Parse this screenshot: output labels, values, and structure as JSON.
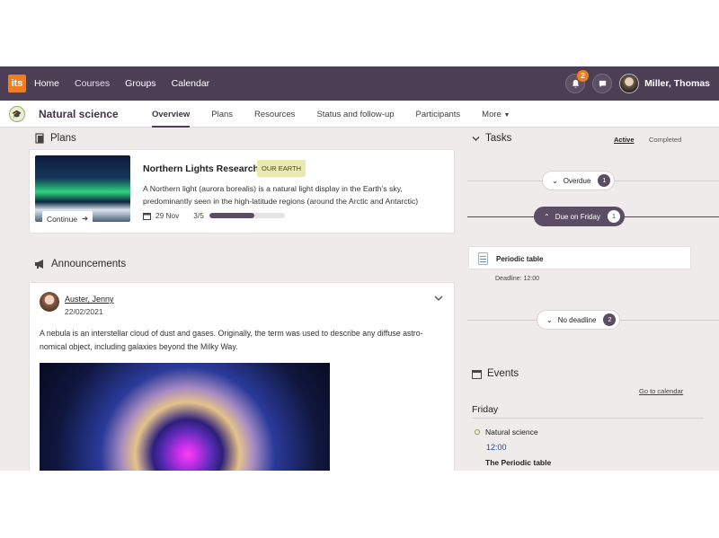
{
  "topbar": {
    "logo": "its",
    "nav": [
      "Home",
      "Courses",
      "Groups",
      "Calendar"
    ],
    "active_nav": "Courses",
    "notification_count": "2",
    "user_name": "Miller, Thomas"
  },
  "subnav": {
    "course_title": "Natural science",
    "tabs": [
      "Overview",
      "Plans",
      "Resources",
      "Status and follow-up",
      "Participants",
      "More"
    ],
    "active_tab": "Overview"
  },
  "plans": {
    "heading": "Plans",
    "card": {
      "continue_label": "Continue",
      "title": "Northern Lights Research",
      "tag": "OUR EARTH",
      "description_line1": "A Northern light (aurora borealis) is a natural light display in the Earth's sky,",
      "description_line2": "predominantly seen in the high-latitude regions (around the Arctic and Antarctic)",
      "date": "29 Nov",
      "progress_text": "3/5",
      "progress_fraction": 0.6
    }
  },
  "announcements": {
    "heading": "Announcements",
    "post": {
      "author": "Auster, Jenny",
      "date": "22/02/2021",
      "text_line1": "A nebula is an interstellar cloud of dust and gases. Originally, the term was used to describe any diffuse astro-",
      "text_line2": "nomical object, including galaxies beyond the Milky Way."
    }
  },
  "tasks": {
    "heading": "Tasks",
    "filters": [
      "Active",
      "Completed"
    ],
    "active_filter": "Active",
    "groups": [
      {
        "label": "Overdue",
        "count": "1"
      },
      {
        "label": "Due on Friday",
        "count": "1"
      },
      {
        "label": "No deadline",
        "count": "2"
      }
    ],
    "item": {
      "name": "Periodic table",
      "deadline": "Deadline: 12:00"
    }
  },
  "events": {
    "heading": "Events",
    "goto_calendar": "Go to calendar",
    "day": "Friday",
    "event": {
      "course": "Natural science",
      "time": "12:00",
      "title": "The Periodic table"
    }
  }
}
